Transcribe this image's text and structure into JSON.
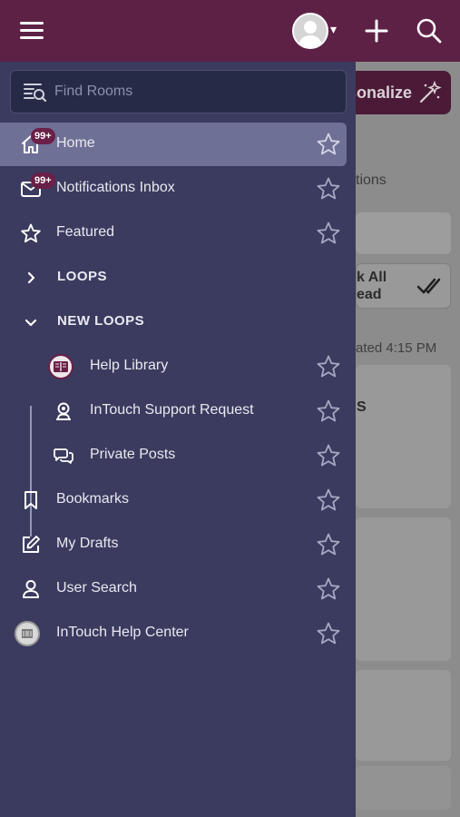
{
  "header": {
    "menu_icon": "hamburger-icon",
    "avatar_icon": "user-avatar-icon",
    "avatar_caret": "▾",
    "add_icon": "plus-icon",
    "search_icon": "search-icon",
    "bar_color": "#5e2146"
  },
  "background": {
    "personalize_label": "sonalize",
    "tab_label": "tions",
    "mark_all_line1": "k All",
    "mark_all_line2": "ead",
    "updated_label": "ated 4:15 PM",
    "card_text": "S"
  },
  "drawer": {
    "search": {
      "placeholder": "Find Rooms"
    },
    "items": [
      {
        "label": "Home",
        "icon": "home-icon",
        "badge": "99+",
        "active": true
      },
      {
        "label": "Notifications Inbox",
        "icon": "mail-icon",
        "badge": "99+"
      },
      {
        "label": "Featured",
        "icon": "star-outline-icon"
      },
      {
        "label": "LOOPS",
        "icon": "chevron-right-icon",
        "section": true
      },
      {
        "label": "NEW LOOPS",
        "icon": "chevron-down-icon",
        "section": true
      },
      {
        "label": "Help Library",
        "icon": "help-library-logo"
      },
      {
        "label": "InTouch Support Request",
        "icon": "support-request-icon"
      },
      {
        "label": "Private Posts",
        "icon": "chat-bubbles-icon"
      },
      {
        "label": "Bookmarks",
        "icon": "bookmark-icon"
      },
      {
        "label": "My Drafts",
        "icon": "edit-icon"
      },
      {
        "label": "User Search",
        "icon": "user-icon"
      },
      {
        "label": "InTouch Help Center",
        "icon": "help-center-logo"
      }
    ],
    "accent_color": "#6a1f47",
    "background_color": "#3b3b5f"
  }
}
